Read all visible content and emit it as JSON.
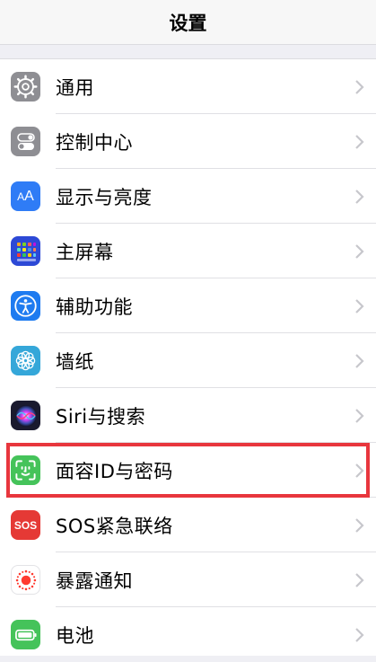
{
  "navbar": {
    "title": "设置"
  },
  "items": [
    {
      "label": "通用",
      "icon": "gear-icon",
      "color": "#8e8e93"
    },
    {
      "label": "控制中心",
      "icon": "toggles-icon",
      "color": "#8e8e93"
    },
    {
      "label": "显示与亮度",
      "icon": "text-size-icon",
      "color": "#2f7cf6"
    },
    {
      "label": "主屏幕",
      "icon": "home-screen-grid-icon",
      "color": "#2d49d6"
    },
    {
      "label": "辅助功能",
      "icon": "accessibility-icon",
      "color": "#1e7bf0"
    },
    {
      "label": "墙纸",
      "icon": "wallpaper-flower-icon",
      "color": "#35a7d9"
    },
    {
      "label": "Siri与搜索",
      "icon": "siri-icon",
      "color": "#1a1a2e"
    },
    {
      "label": "面容ID与密码",
      "icon": "face-id-icon",
      "color": "#45c35a"
    },
    {
      "label": "SOS紧急联络",
      "icon": "sos-icon",
      "color": "#e53935",
      "icon_text": "SOS"
    },
    {
      "label": "暴露通知",
      "icon": "exposure-notification-icon",
      "color": "#ffffff"
    },
    {
      "label": "电池",
      "icon": "battery-icon",
      "color": "#45c35a"
    }
  ],
  "colors": {
    "highlight": "#e8363d",
    "chevron": "#c7c7cc"
  }
}
